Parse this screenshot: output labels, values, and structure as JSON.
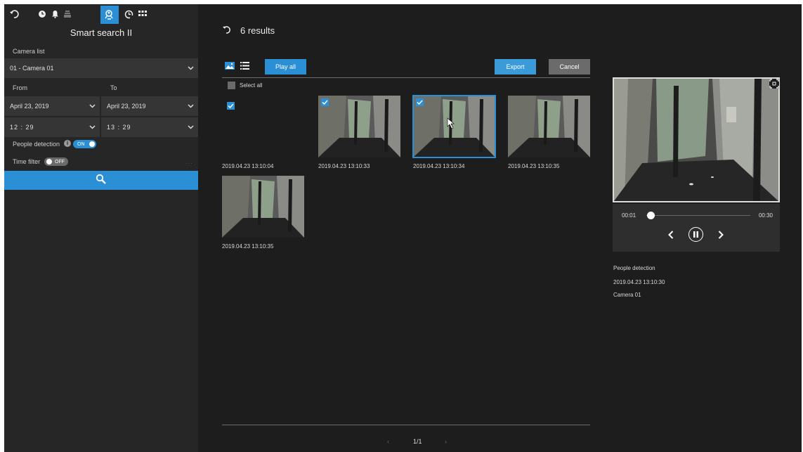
{
  "sidebar": {
    "title": "Smart search II",
    "camera_list_label": "Camera list",
    "camera_value": "01 - Camera 01",
    "from_label": "From",
    "to_label": "To",
    "from_date": "April 23, 2019",
    "to_date": "April 23, 2019",
    "from_time": "12 : 29",
    "to_time": "13 : 29",
    "people_detection_label": "People detection",
    "people_detection_state": "ON",
    "time_filter_label": "Time filter",
    "time_filter_state": "OFF"
  },
  "topbar_icons": [
    "back-icon",
    "clock-icon",
    "bell-icon",
    "dashboard-icon",
    "smart-search-icon",
    "playback-icon",
    "grid-icon"
  ],
  "main": {
    "results_text": "6 results",
    "play_all_label": "Play all",
    "export_label": "Export",
    "cancel_label": "Cancel",
    "select_all_label": "Select all",
    "page_indicator": "1/1"
  },
  "results": [
    {
      "timestamp": "2019.04.23 13:10:04",
      "checked": true,
      "has_image": false
    },
    {
      "timestamp": "2019.04.23 13:10:33",
      "checked": true,
      "has_image": true
    },
    {
      "timestamp": "2019.04.23 13:10:34",
      "checked": true,
      "has_image": true,
      "selected": true
    },
    {
      "timestamp": "2019.04.23 13:10:35",
      "checked": false,
      "has_image": true
    },
    {
      "timestamp": "2019.04.23 13:10:35",
      "checked": false,
      "has_image": true
    }
  ],
  "player": {
    "current_time": "00:01",
    "total_time": "00:30",
    "progress": 0.04
  },
  "details": {
    "event_type": "People detection",
    "event_time": "2019.04.23 13:10:30",
    "camera_name": "Camera 01"
  },
  "colors": {
    "accent": "#2a8fd4",
    "background": "#1d1d1d",
    "sidebar": "#262626"
  }
}
